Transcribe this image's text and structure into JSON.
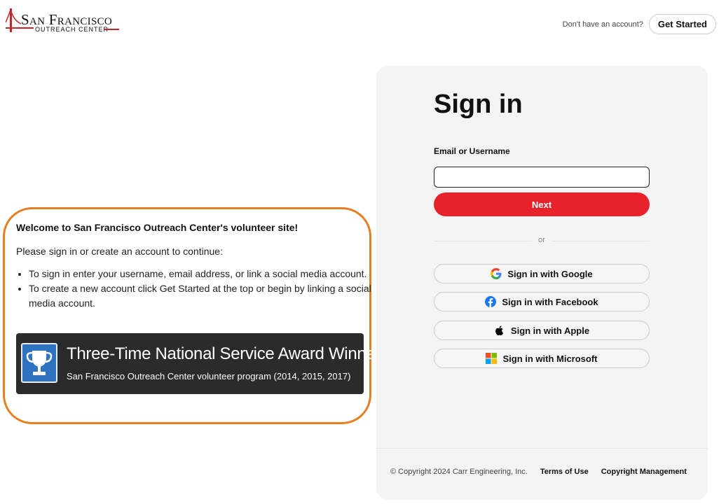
{
  "header": {
    "logo_brand": "San Francisco",
    "logo_sub": "OUTREACH CENTER",
    "account_prompt": "Don't have an account?",
    "get_started_label": "Get Started"
  },
  "welcome": {
    "heading": "Welcome to San Francisco Outreach Center's volunteer site!",
    "intro": "Please sign in or create an account to continue:",
    "bullets": [
      "To sign in enter your username, email address, or link a social media account.",
      "To create a new account click Get Started at the top or begin by linking a social media account."
    ],
    "award": {
      "icon": "trophy-icon",
      "title": "Three-Time National Service Award Winner",
      "subtitle": "San Francisco Outreach Center volunteer program (2014, 2015, 2017)"
    }
  },
  "signin": {
    "title": "Sign in",
    "email_label": "Email or Username",
    "email_value": "",
    "next_label": "Next",
    "divider": "or",
    "social": [
      {
        "icon": "google-icon",
        "label": "Sign in with Google"
      },
      {
        "icon": "facebook-icon",
        "label": "Sign in with Facebook"
      },
      {
        "icon": "apple-icon",
        "label": "Sign in with Apple"
      },
      {
        "icon": "microsoft-icon",
        "label": "Sign in with Microsoft"
      }
    ]
  },
  "footer": {
    "copyright": "© Copyright 2024 Carr Engineering, Inc.",
    "terms": "Terms of Use",
    "copyright_mgmt": "Copyright Management"
  },
  "colors": {
    "accent_red": "#e8222a",
    "welcome_border": "#e67e22",
    "award_bg": "#2b2b2b",
    "trophy_blue": "#2f74c0"
  }
}
